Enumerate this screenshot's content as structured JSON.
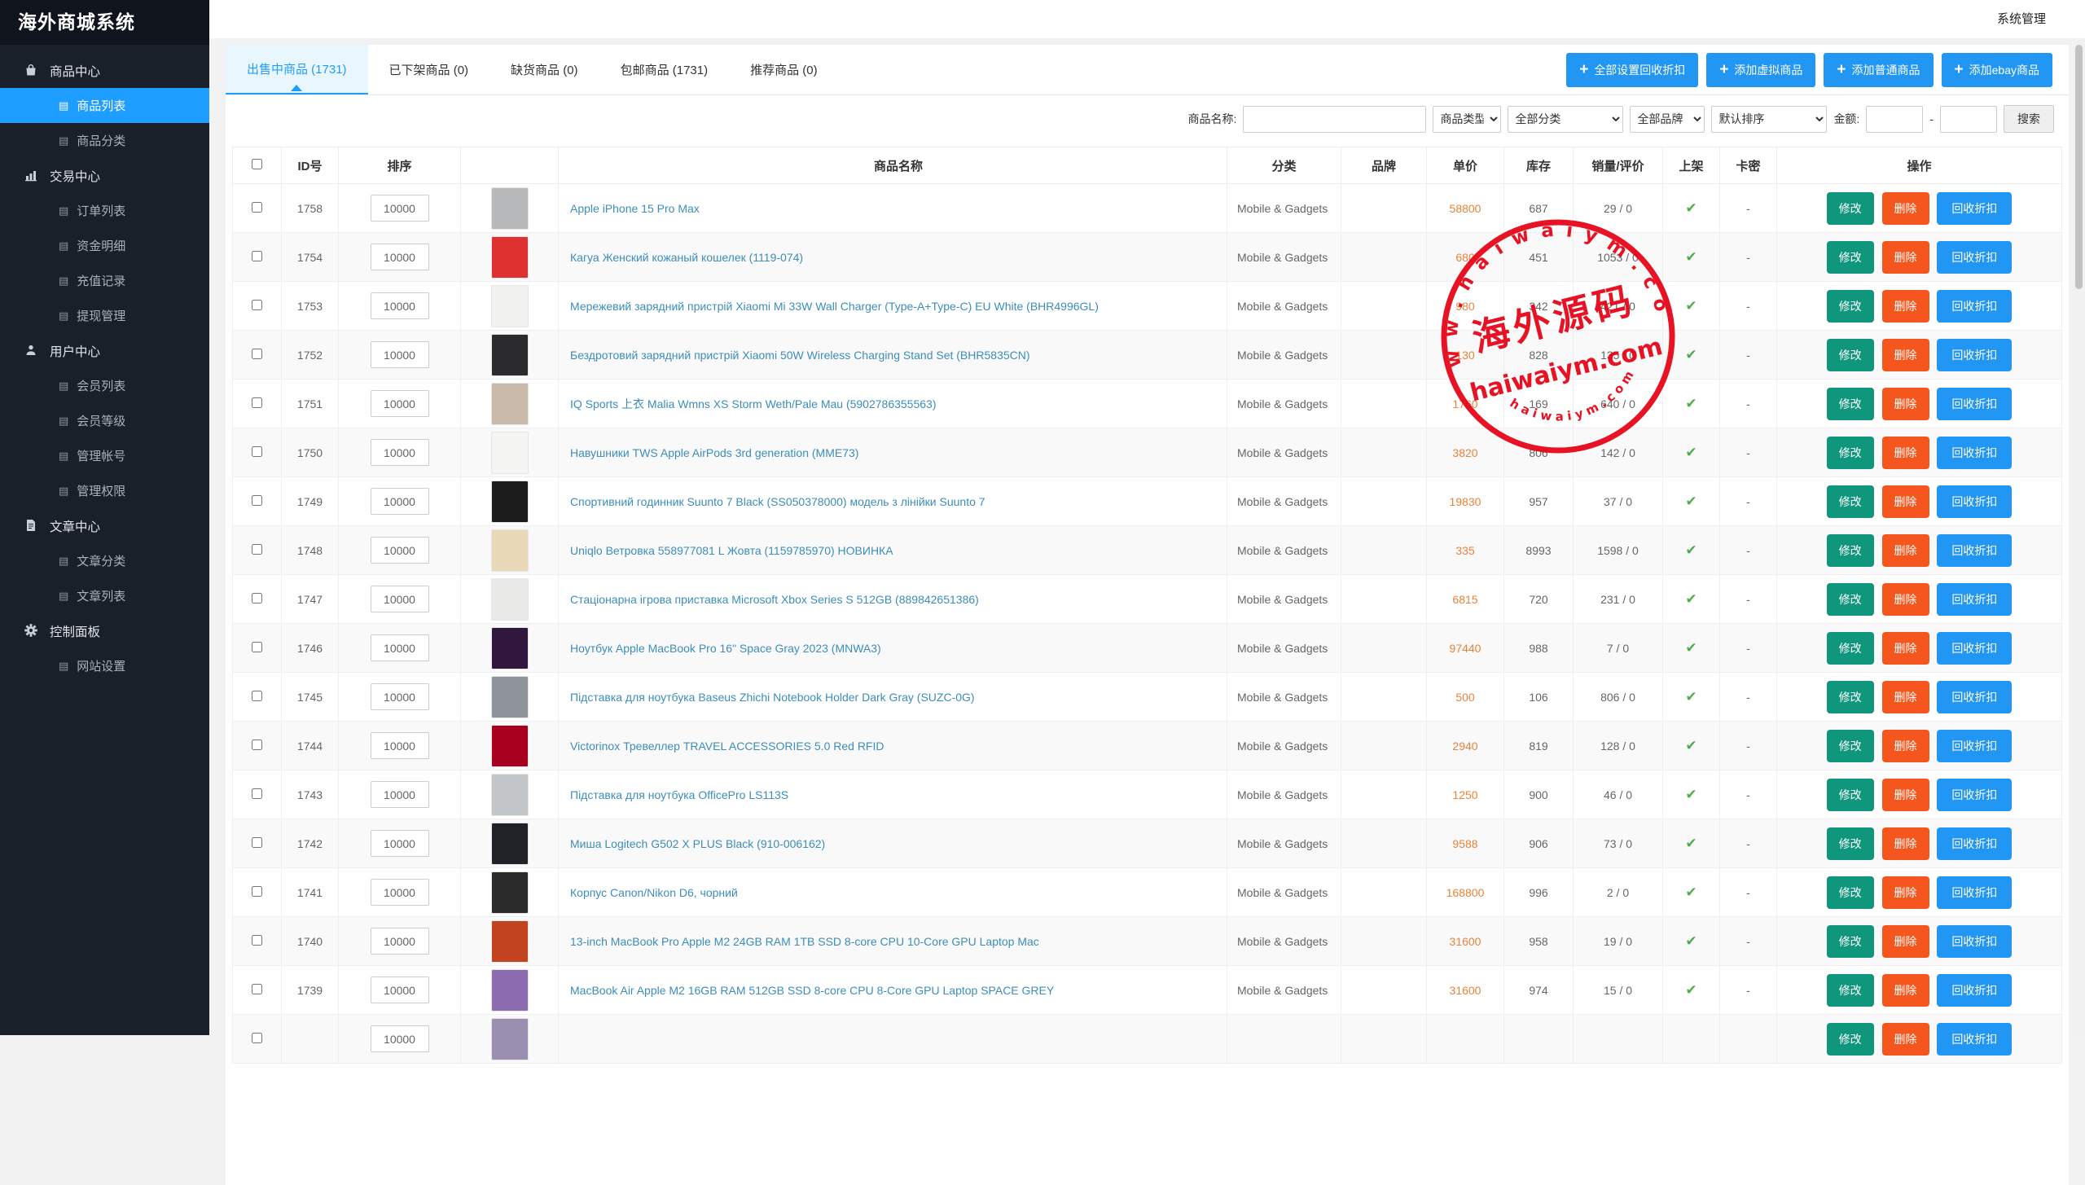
{
  "app": {
    "title": "海外商城系统",
    "admin_label": "系统管理"
  },
  "sidebar": {
    "sections": [
      {
        "label": "商品中心",
        "icon": "shopping-bag-icon",
        "items": [
          {
            "label": "商品列表",
            "active": true
          },
          {
            "label": "商品分类",
            "active": false
          }
        ]
      },
      {
        "label": "交易中心",
        "icon": "bar-chart-icon",
        "items": [
          {
            "label": "订单列表",
            "active": false
          },
          {
            "label": "资金明细",
            "active": false
          },
          {
            "label": "充值记录",
            "active": false
          },
          {
            "label": "提现管理",
            "active": false
          }
        ]
      },
      {
        "label": "用户中心",
        "icon": "user-icon",
        "items": [
          {
            "label": "会员列表",
            "active": false
          },
          {
            "label": "会员等级",
            "active": false
          },
          {
            "label": "管理帐号",
            "active": false
          },
          {
            "label": "管理权限",
            "active": false
          }
        ]
      },
      {
        "label": "文章中心",
        "icon": "document-icon",
        "items": [
          {
            "label": "文章分类",
            "active": false
          },
          {
            "label": "文章列表",
            "active": false
          }
        ]
      },
      {
        "label": "控制面板",
        "icon": "gear-icon",
        "items": [
          {
            "label": "网站设置",
            "active": false
          }
        ]
      }
    ]
  },
  "tabs": [
    {
      "label": "出售中商品 (1731)",
      "active": true
    },
    {
      "label": "已下架商品 (0)",
      "active": false
    },
    {
      "label": "缺货商品 (0)",
      "active": false
    },
    {
      "label": "包邮商品 (1731)",
      "active": false
    },
    {
      "label": "推荐商品 (0)",
      "active": false
    }
  ],
  "actions": [
    {
      "label": "全部设置回收折扣"
    },
    {
      "label": "添加虚拟商品"
    },
    {
      "label": "添加普通商品"
    },
    {
      "label": "添加ebay商品"
    }
  ],
  "filters": {
    "name_label": "商品名称:",
    "type_select": "商品类型",
    "category_select": "全部分类",
    "brand_select": "全部品牌",
    "sort_select": "默认排序",
    "amount_label": "金额:",
    "range_separator": "-",
    "search_label": "搜索"
  },
  "table": {
    "headers": [
      "ID号",
      "排序",
      "",
      "商品名称",
      "分类",
      "品牌",
      "单价",
      "库存",
      "销量/评价",
      "上架",
      "卡密",
      "操作"
    ],
    "row_actions": [
      "修改",
      "删除",
      "回收折扣"
    ],
    "rows": [
      {
        "id": "1758",
        "sort": "10000",
        "name": "Apple iPhone 15 Pro Max",
        "category": "Mobile & Gadgets",
        "brand": "",
        "price": "58800",
        "stock": "687",
        "sales": "29 / 0",
        "listed": true,
        "card": "-",
        "image_color": "#b7b9ba"
      },
      {
        "id": "1754",
        "sort": "10000",
        "name": "Кагуа Женский кожаный кошелек (1119-074)",
        "category": "Mobile & Gadgets",
        "brand": "",
        "price": "680",
        "stock": "451",
        "sales": "1053 / 0",
        "listed": true,
        "card": "-",
        "image_color": "#e03131"
      },
      {
        "id": "1753",
        "sort": "10000",
        "name": "Мережевий зарядний пристрій Xiaomi Mi 33W Wall Charger (Type-A+Type-C) EU White (BHR4996GL)",
        "category": "Mobile & Gadgets",
        "brand": "",
        "price": "980",
        "stock": "342",
        "sales": "421 / 0",
        "listed": true,
        "card": "-",
        "image_color": "#f1f1ef"
      },
      {
        "id": "1752",
        "sort": "10000",
        "name": "Бездротовий зарядний пристрій Xiaomi 50W Wireless Charging Stand Set (BHR5835CN)",
        "category": "Mobile & Gadgets",
        "brand": "",
        "price": "130",
        "stock": "828",
        "sales": "135 / 0",
        "listed": true,
        "card": "-",
        "image_color": "#2b2b2e"
      },
      {
        "id": "1751",
        "sort": "10000",
        "name": "IQ Sports 上衣 Malia Wmns XS Storm Weth/Pale Mau (5902786355563)",
        "category": "Mobile & Gadgets",
        "brand": "",
        "price": "1760",
        "stock": "169",
        "sales": "640 / 0",
        "listed": true,
        "card": "-",
        "image_color": "#c9b9a8"
      },
      {
        "id": "1750",
        "sort": "10000",
        "name": "Навушники TWS Apple AirPods 3rd generation (MME73)",
        "category": "Mobile & Gadgets",
        "brand": "",
        "price": "3820",
        "stock": "806",
        "sales": "142 / 0",
        "listed": true,
        "card": "-",
        "image_color": "#f4f4f2"
      },
      {
        "id": "1749",
        "sort": "10000",
        "name": "Спортивний годинник Suunto 7 Black (SS050378000) модель з лінійки Suunto 7",
        "category": "Mobile & Gadgets",
        "brand": "",
        "price": "19830",
        "stock": "957",
        "sales": "37 / 0",
        "listed": true,
        "card": "-",
        "image_color": "#1c1c1c"
      },
      {
        "id": "1748",
        "sort": "10000",
        "name": "Uniqlo Ветровка 558977081 L Жовта (1159785970) НОВИНКА",
        "category": "Mobile & Gadgets",
        "brand": "",
        "price": "335",
        "stock": "8993",
        "sales": "1598 / 0",
        "listed": true,
        "card": "-",
        "image_color": "#ead9b9"
      },
      {
        "id": "1747",
        "sort": "10000",
        "name": "Стаціонарна ігрова приставка Microsoft Xbox Series S 512GB (889842651386)",
        "category": "Mobile & Gadgets",
        "brand": "",
        "price": "6815",
        "stock": "720",
        "sales": "231 / 0",
        "listed": true,
        "card": "-",
        "image_color": "#e9e9e7"
      },
      {
        "id": "1746",
        "sort": "10000",
        "name": "Ноутбук Apple MacBook Pro 16\" Space Gray 2023 (MNWA3)",
        "category": "Mobile & Gadgets",
        "brand": "",
        "price": "97440",
        "stock": "988",
        "sales": "7 / 0",
        "listed": true,
        "card": "-",
        "image_color": "#31173d"
      },
      {
        "id": "1745",
        "sort": "10000",
        "name": "Підставка для ноутбука Baseus Zhichi Notebook Holder Dark Gray (SUZC-0G)",
        "category": "Mobile & Gadgets",
        "brand": "",
        "price": "500",
        "stock": "106",
        "sales": "806 / 0",
        "listed": true,
        "card": "-",
        "image_color": "#8e9499"
      },
      {
        "id": "1744",
        "sort": "10000",
        "name": "Victorinox Тревеллер TRAVEL ACCESSORIES 5.0 Red RFID",
        "category": "Mobile & Gadgets",
        "brand": "",
        "price": "2940",
        "stock": "819",
        "sales": "128 / 0",
        "listed": true,
        "card": "-",
        "image_color": "#a8001e"
      },
      {
        "id": "1743",
        "sort": "10000",
        "name": "Підставка для ноутбука OfficePro LS113S",
        "category": "Mobile & Gadgets",
        "brand": "",
        "price": "1250",
        "stock": "900",
        "sales": "46 / 0",
        "listed": true,
        "card": "-",
        "image_color": "#c2c6c9"
      },
      {
        "id": "1742",
        "sort": "10000",
        "name": "Миша Logitech G502 X PLUS Black (910-006162)",
        "category": "Mobile & Gadgets",
        "brand": "",
        "price": "9588",
        "stock": "906",
        "sales": "73 / 0",
        "listed": true,
        "card": "-",
        "image_color": "#202227"
      },
      {
        "id": "1741",
        "sort": "10000",
        "name": "Корпус Canon/Nikon D6, чорний",
        "category": "Mobile & Gadgets",
        "brand": "",
        "price": "168800",
        "stock": "996",
        "sales": "2 / 0",
        "listed": true,
        "card": "-",
        "image_color": "#2a2a2a"
      },
      {
        "id": "1740",
        "sort": "10000",
        "name": "13-inch MacBook Pro Apple M2 24GB RAM 1TB SSD 8-core CPU 10-Core GPU Laptop Mac",
        "category": "Mobile & Gadgets",
        "brand": "",
        "price": "31600",
        "stock": "958",
        "sales": "19 / 0",
        "listed": true,
        "card": "-",
        "image_color": "#c2431f"
      },
      {
        "id": "1739",
        "sort": "10000",
        "name": "MacBook Air Apple M2 16GB RAM 512GB SSD 8-core CPU 8-Core GPU Laptop SPACE GREY",
        "category": "Mobile & Gadgets",
        "brand": "",
        "price": "31600",
        "stock": "974",
        "sales": "15 / 0",
        "listed": true,
        "card": "-",
        "image_color": "#8d6bb0"
      },
      {
        "id": "",
        "sort": "10000",
        "name": "",
        "category": "",
        "brand": "",
        "price": "",
        "stock": "",
        "sales": "",
        "listed": false,
        "card": "",
        "image_color": "#9a8fb0"
      }
    ]
  },
  "watermark": {
    "top_arc": "w w w . h a i w a i y m . c o m",
    "center_text": "海外源码",
    "domain": "haiwaiym.com",
    "bottom_arc": "h a i w a i y m . c o m",
    "color": "#e60012"
  },
  "colors": {
    "sidebar_bg": "#1a2029",
    "active_item": "#1e9fff",
    "button_blue": "#2196f3",
    "edit_button": "#11967e",
    "delete_button": "#f4561e",
    "price_text": "#e8833a",
    "link_text": "#3c8dbc",
    "check_green": "#4cae4c",
    "watermark_red": "#e60012"
  }
}
